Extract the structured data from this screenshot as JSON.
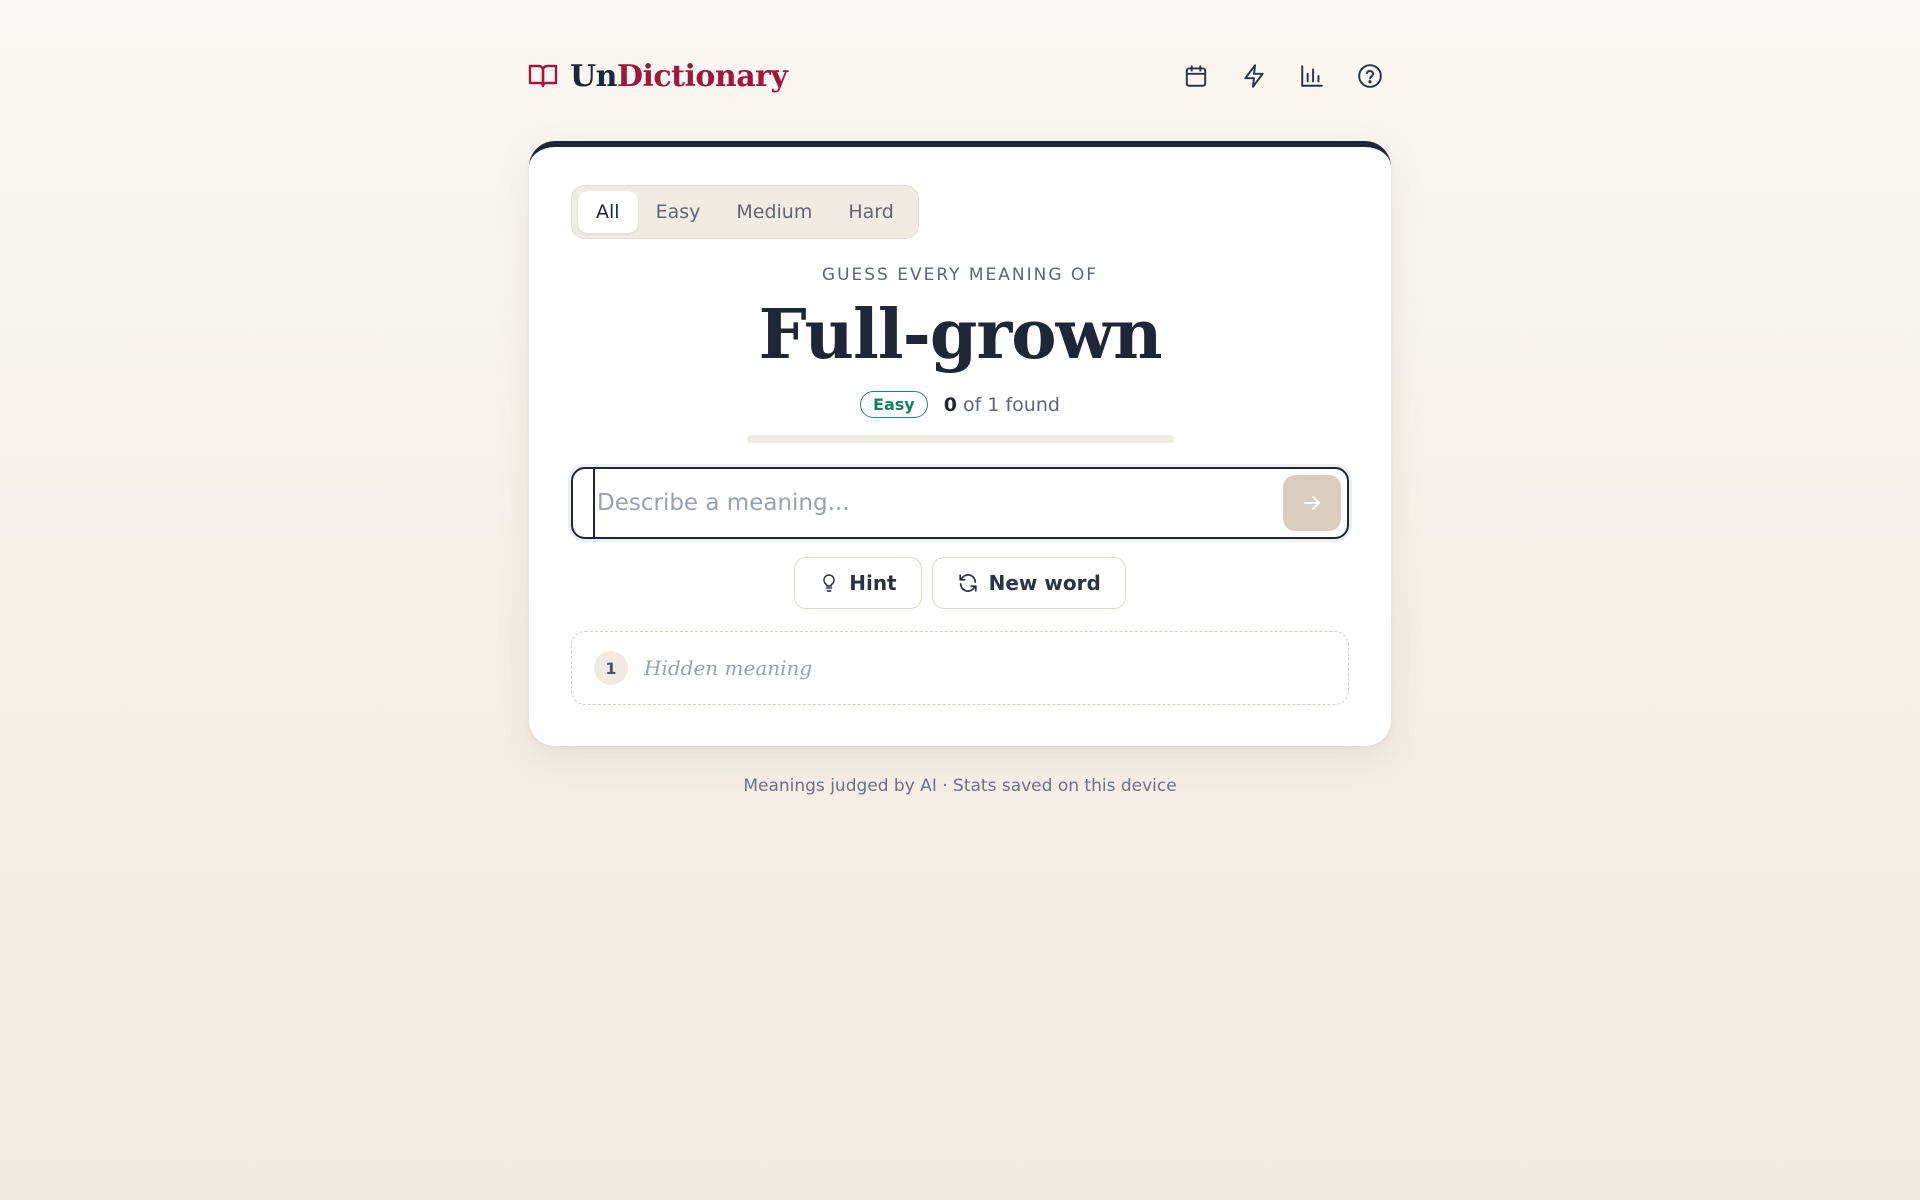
{
  "brand": {
    "name_part1": "Un",
    "name_part2": "Dictionary",
    "icon": "open-book-icon",
    "accent_color": "#a0173a"
  },
  "header_icons": [
    {
      "icon": "calendar-icon"
    },
    {
      "icon": "lightning-icon"
    },
    {
      "icon": "stats-chart-icon"
    },
    {
      "icon": "help-circle-icon"
    }
  ],
  "difficulty_tabs": {
    "items": [
      "All",
      "Easy",
      "Medium",
      "Hard"
    ],
    "selected": "All"
  },
  "game": {
    "prompt": "GUESS EVERY MEANING OF",
    "word": "Full-grown",
    "difficulty_badge": "Easy",
    "found_count": "0",
    "found_suffix": "of 1 found",
    "progress_fraction": 0
  },
  "input": {
    "placeholder": "Describe a meaning...",
    "value": ""
  },
  "actions": {
    "hint_label": "Hint",
    "new_word_label": "New word"
  },
  "meanings": [
    {
      "number": "1",
      "text": "Hidden meaning"
    }
  ],
  "footer": {
    "text": "Meanings judged by AI · Stats saved on this device"
  },
  "colors": {
    "ink": "#1e2638",
    "easy_green": "#1e8e6a",
    "submit_bg": "#d9cdbf"
  }
}
